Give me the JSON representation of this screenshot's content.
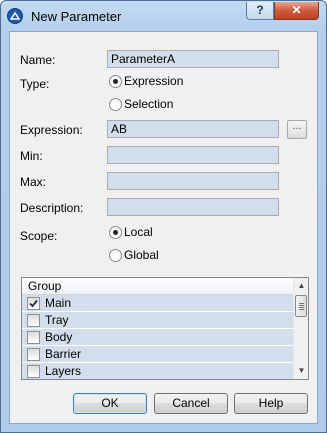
{
  "window": {
    "title": "New Parameter",
    "help_label": "?",
    "close_label": "✕"
  },
  "form": {
    "name_label": "Name:",
    "name_value": "ParameterA",
    "type_label": "Type:",
    "type_options": [
      "Expression",
      "Selection"
    ],
    "type_selected": "Expression",
    "expression_label": "Expression:",
    "expression_value": "AB",
    "browse_label": "...",
    "min_label": "Min:",
    "min_value": "",
    "max_label": "Max:",
    "max_value": "",
    "description_label": "Description:",
    "description_value": "",
    "scope_label": "Scope:",
    "scope_options": [
      "Local",
      "Global"
    ],
    "scope_selected": "Local"
  },
  "group_list": {
    "header": "Group",
    "items": [
      {
        "label": "Main",
        "checked": true
      },
      {
        "label": "Tray",
        "checked": false
      },
      {
        "label": "Body",
        "checked": false
      },
      {
        "label": "Barrier",
        "checked": false
      },
      {
        "label": "Layers",
        "checked": false
      }
    ]
  },
  "buttons": {
    "ok": "OK",
    "cancel": "Cancel",
    "help": "Help"
  }
}
